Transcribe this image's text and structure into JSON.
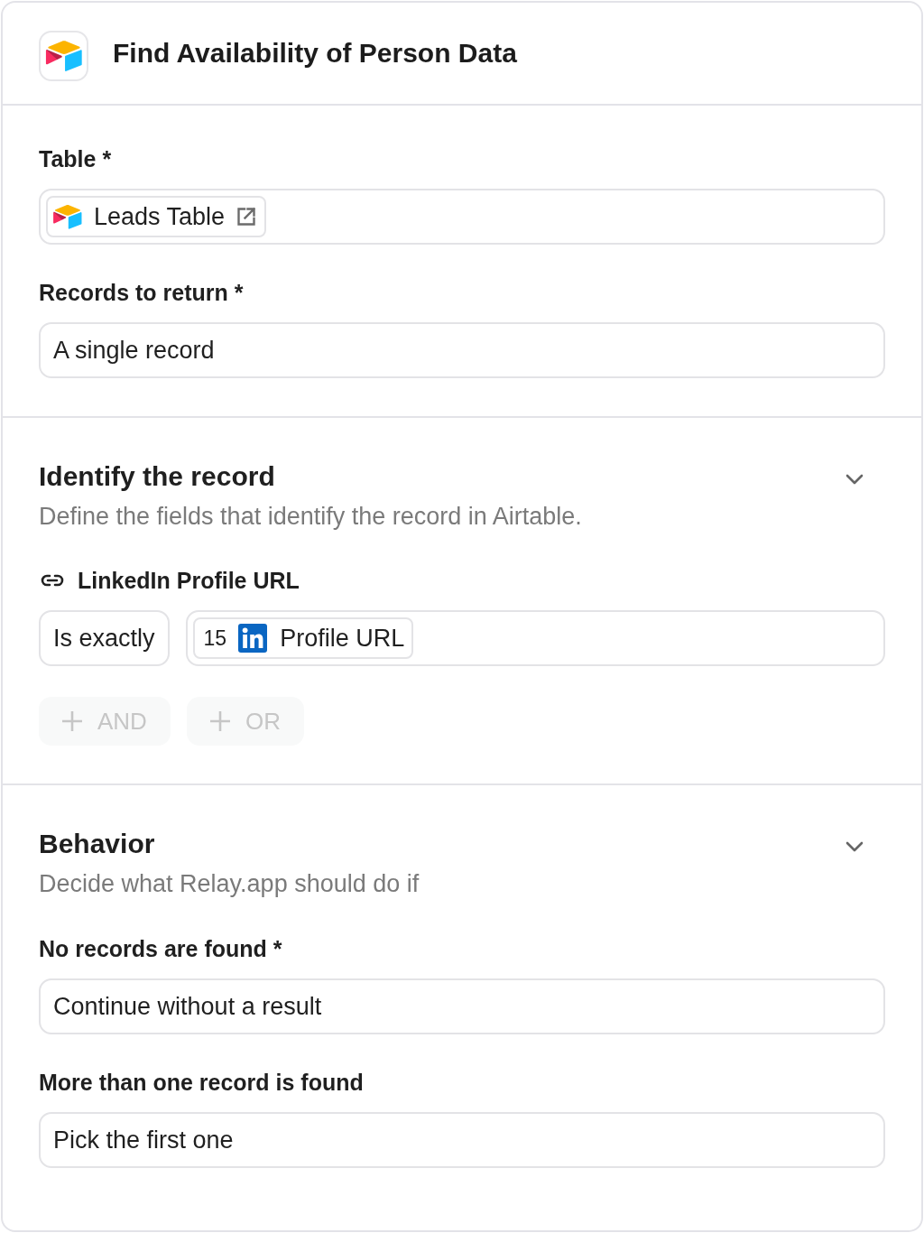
{
  "header": {
    "title": "Find Availability of Person Data"
  },
  "table_section": {
    "fields": [
      {
        "label": "Table *",
        "kind": "record",
        "value": "Leads Table"
      },
      {
        "label": "Records to return *",
        "kind": "text",
        "value": "A single record"
      }
    ]
  },
  "identify": {
    "title": "Identify the record",
    "subtitle": "Define the fields that identify the record in Airtable.",
    "condition": {
      "field": "LinkedIn Profile URL",
      "operator": "Is exactly",
      "token": {
        "step": "15",
        "label": "Profile URL"
      }
    },
    "buttons": [
      {
        "label": "AND",
        "disabled": true
      },
      {
        "label": "OR",
        "disabled": true
      }
    ]
  },
  "behavior": {
    "title": "Behavior",
    "subtitle": "Decide what Relay.app should do if",
    "fields": [
      {
        "label": "No records are found *",
        "kind": "text",
        "value": "Continue without a result"
      },
      {
        "label": "More than one record is found",
        "kind": "text",
        "value": "Pick the first one"
      }
    ]
  }
}
